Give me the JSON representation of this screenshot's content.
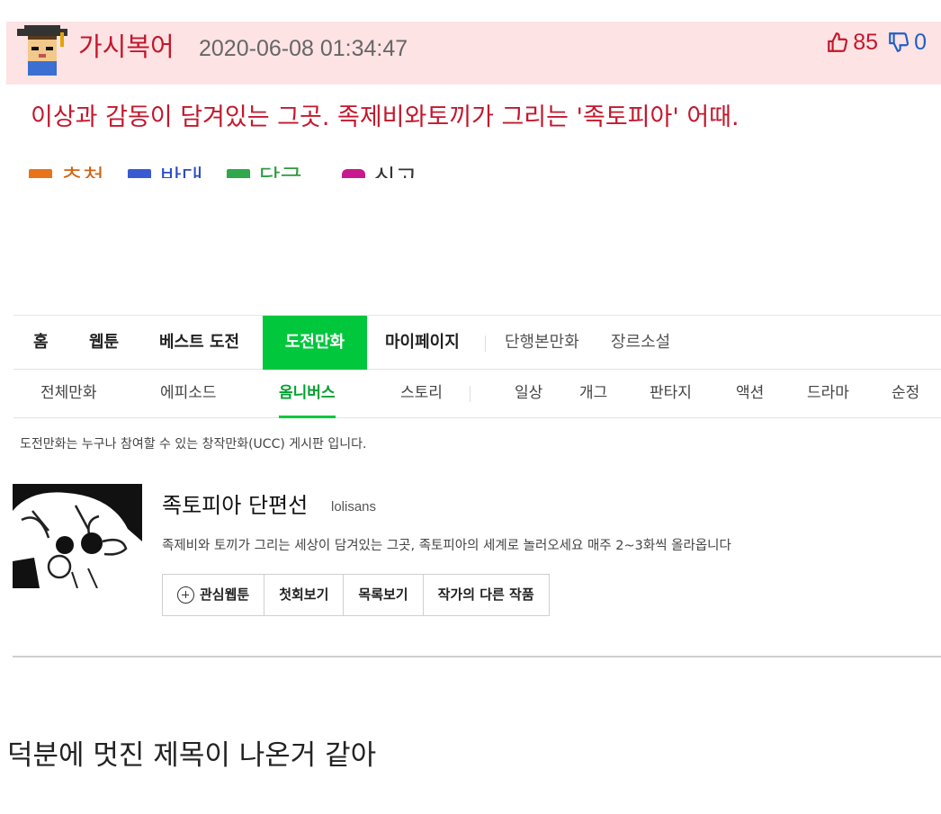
{
  "comment": {
    "nickname": "가시복어",
    "timestamp": "2020-06-08 01:34:47",
    "upvotes": "85",
    "downvotes": "0",
    "text": "이상과 감동이 담겨있는 그곳. 족제비와토끼가 그리는 '족토피아' 어때.",
    "actions": {
      "recommend": "추천",
      "oppose": "반대",
      "reply": "답글",
      "report": "신고"
    },
    "colors": {
      "header_bg": "#fde3e4",
      "accent_red": "#c4172c",
      "down_blue": "#1f5fc8"
    }
  },
  "webtoon": {
    "gnb": [
      {
        "label": "홈"
      },
      {
        "label": "웹툰"
      },
      {
        "label": "베스트 도전"
      },
      {
        "label": "도전만화"
      },
      {
        "label": "마이페이지"
      },
      {
        "label": "단행본만화"
      },
      {
        "label": "장르소설"
      }
    ],
    "active_gnb": "도전만화",
    "sub_nav": [
      {
        "label": "전체만화"
      },
      {
        "label": "에피소드"
      },
      {
        "label": "옴니버스"
      },
      {
        "label": "스토리"
      },
      {
        "label": "일상"
      },
      {
        "label": "개그"
      },
      {
        "label": "판타지"
      },
      {
        "label": "액션"
      },
      {
        "label": "드라마"
      },
      {
        "label": "순정"
      }
    ],
    "active_sub": "옴니버스",
    "board_desc": "도전만화는 누구나 참여할 수 있는 창작만화(UCC) 게시판 입니다.",
    "series": {
      "title": "족토피아 단편선",
      "author": "lolisans",
      "description": "족제비와 토끼가 그리는 세상이 담겨있는 그곳, 족토피아의 세계로 놀러오세요 매주 2~3화씩 올라옵니다"
    },
    "buttons": {
      "favorite": "관심웹툰",
      "first": "첫회보기",
      "list": "목록보기",
      "other": "작가의 다른 작품"
    },
    "colors": {
      "brand_green": "#00c73c"
    }
  },
  "footer_text": "덕분에 멋진 제목이 나온거 같아"
}
